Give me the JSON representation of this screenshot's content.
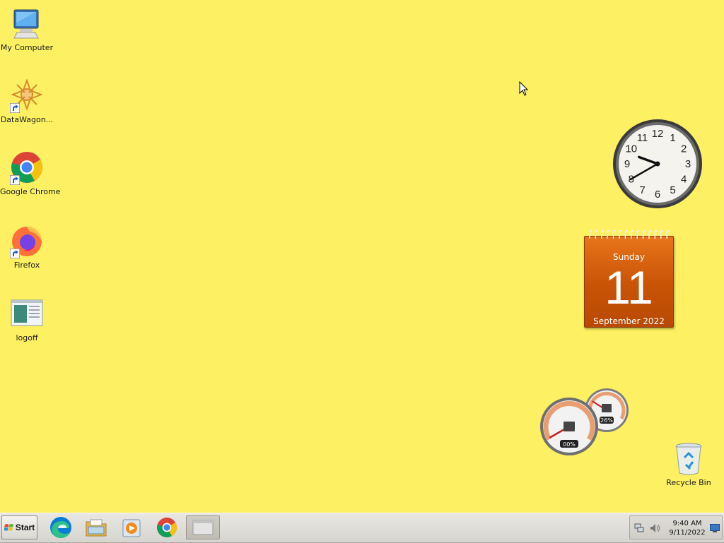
{
  "desktop": {
    "background_color": "#fdf062",
    "icons": [
      {
        "label": "My Computer",
        "icon": "computer-icon"
      },
      {
        "label": "DataWagon...",
        "icon": "datawagon-icon"
      },
      {
        "label": "Google Chrome",
        "icon": "chrome-icon"
      },
      {
        "label": "Firefox",
        "icon": "firefox-icon"
      },
      {
        "label": "logoff",
        "icon": "logoff-icon"
      },
      {
        "label": "Recycle Bin",
        "icon": "recycle-bin-icon"
      }
    ]
  },
  "gadgets": {
    "clock": {
      "time": "9:40",
      "numerals": [
        "12",
        "1",
        "2",
        "3",
        "4",
        "5",
        "6",
        "7",
        "8",
        "9",
        "10",
        "11"
      ]
    },
    "calendar": {
      "weekday": "Sunday",
      "day": "11",
      "month_year": "September 2022",
      "color": "#c85306"
    },
    "meter": {
      "cpu_label": "00%",
      "memory_label": "26%",
      "cpu": 0,
      "memory": 26
    }
  },
  "taskbar": {
    "start_label": "Start",
    "pinned": [
      {
        "name": "edge",
        "icon": "edge-icon"
      },
      {
        "name": "file-explorer",
        "icon": "folder-icon"
      },
      {
        "name": "media-player",
        "icon": "media-player-icon"
      },
      {
        "name": "chrome",
        "icon": "chrome-icon"
      },
      {
        "name": "window",
        "icon": "window-icon"
      }
    ],
    "tray": {
      "time": "9:40 AM",
      "date": "9/11/2022"
    }
  }
}
